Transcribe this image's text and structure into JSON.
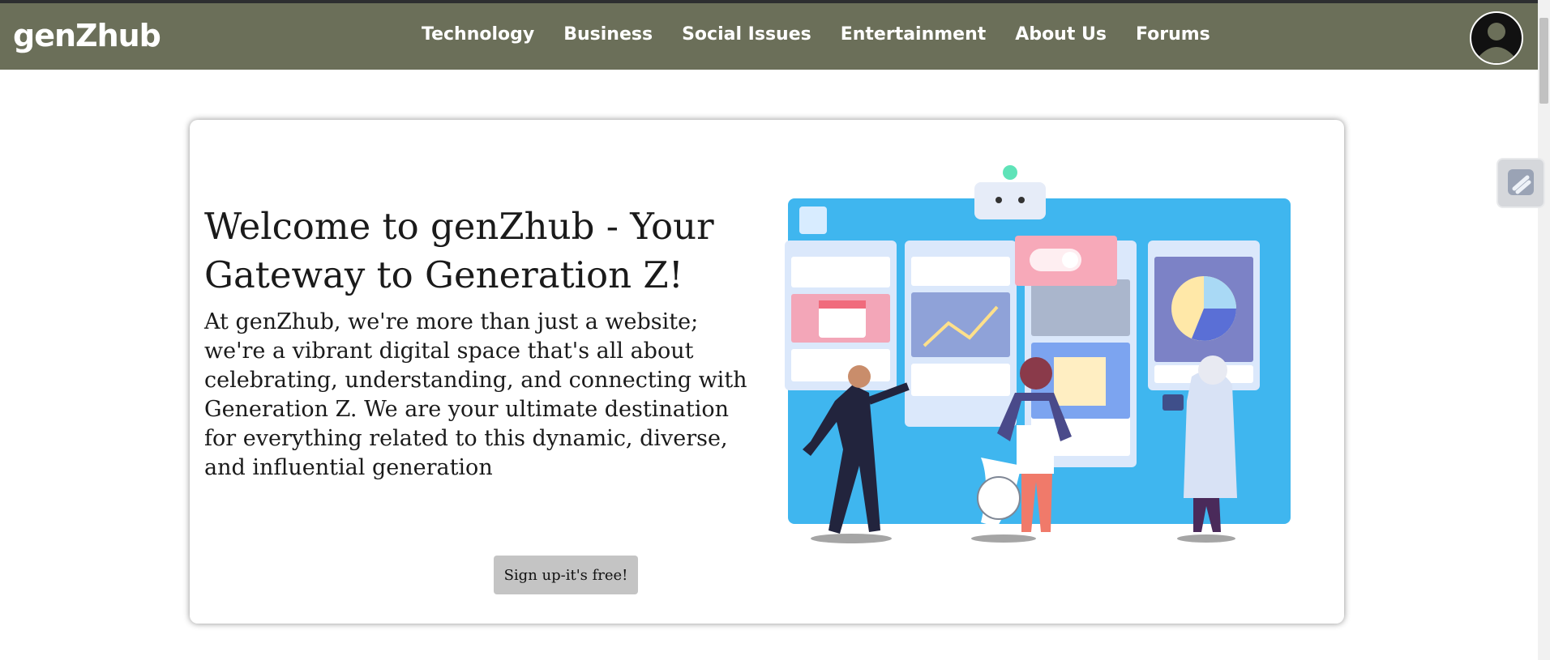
{
  "header": {
    "logo": "genZhub",
    "nav": [
      "Technology",
      "Business",
      "Social Issues",
      "Entertainment",
      "About Us",
      "Forums"
    ]
  },
  "hero": {
    "title": "Welcome to genZhub - Your Gateway to Generation Z!",
    "description": "At genZhub, we're more than just a website; we're a vibrant digital space that's all about celebrating, understanding, and connecting with Generation Z. We are your ultimate destination for everything related to this dynamic, diverse, and influential generation",
    "signup_label": "Sign up-it's free!"
  },
  "colors": {
    "navbar": "#6b6f59",
    "button": "#c4c4c4",
    "illustration_bg": "#3fb6ef"
  },
  "icons": [
    "avatar-icon",
    "side-widget-icon"
  ]
}
